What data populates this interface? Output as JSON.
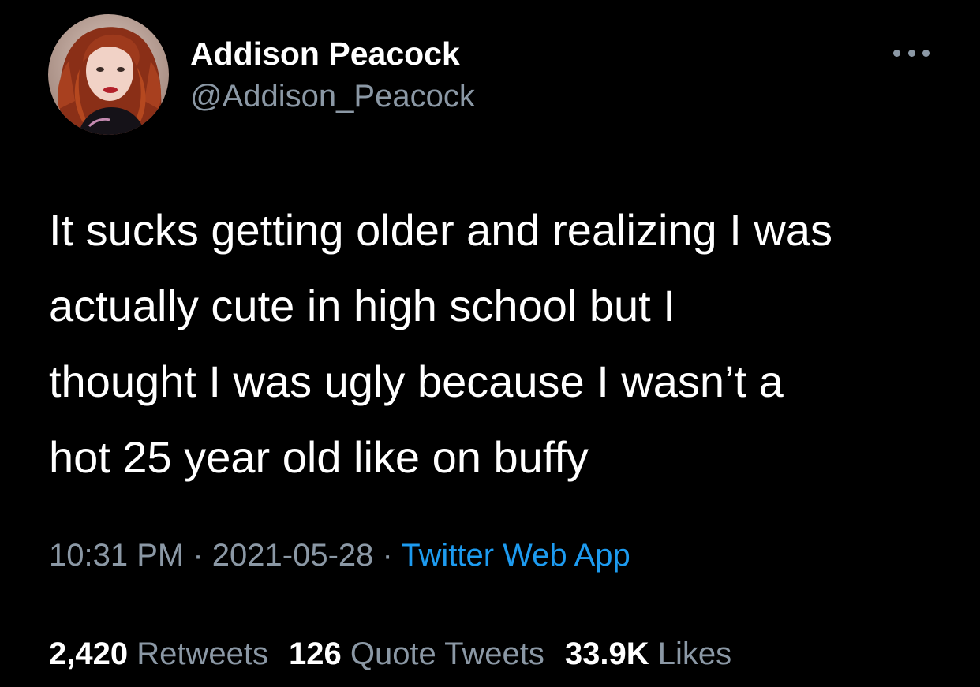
{
  "tweet": {
    "author": {
      "display_name": "Addison Peacock",
      "handle": "@Addison_Peacock",
      "avatar_icon": "profile-photo"
    },
    "more_icon": "more-options-icon",
    "text_lines": [
      "It sucks getting older and realizing I was",
      "actually cute in high school but I",
      "thought I was ugly because I wasn’t a",
      "hot 25 year old like on buffy"
    ],
    "time": "10:31 PM",
    "separator": "·",
    "date": "2021-05-28",
    "source": "Twitter Web App",
    "stats": {
      "retweets_count": "2,420",
      "retweets_label": "Retweets",
      "quotes_count": "126",
      "quotes_label": "Quote Tweets",
      "likes_count": "33.9K",
      "likes_label": "Likes"
    }
  },
  "colors": {
    "background": "#000000",
    "primary_text": "#ffffff",
    "secondary_text": "#8b98a5",
    "link": "#1d9bf0",
    "divider": "#2f3336"
  }
}
